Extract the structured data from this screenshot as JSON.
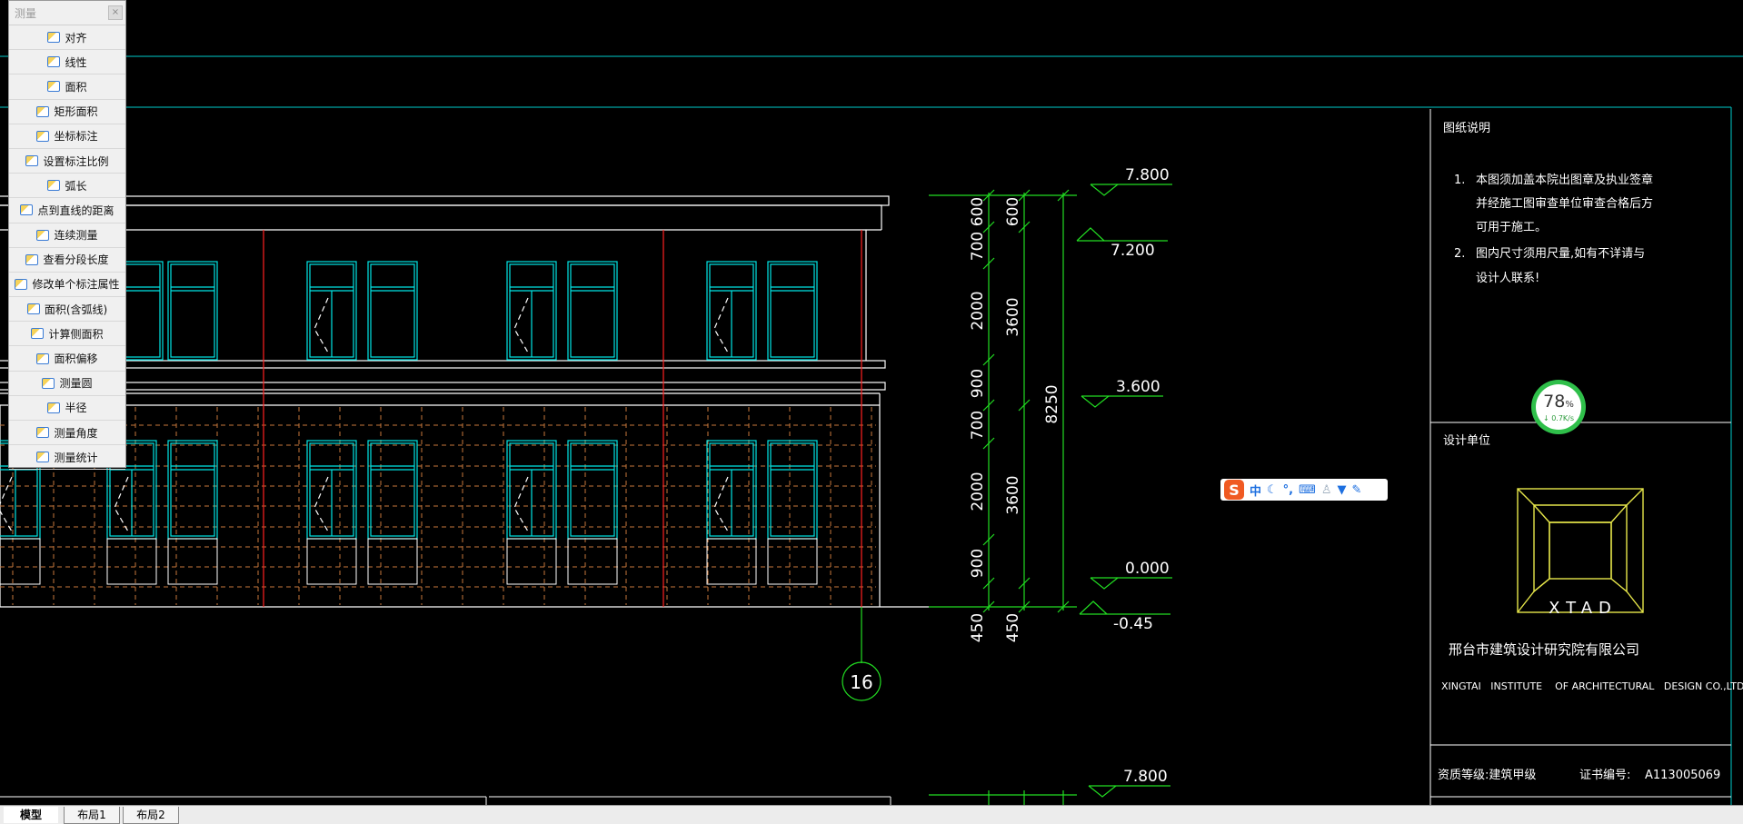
{
  "palette": {
    "title": "测量",
    "close_symbol": "×",
    "items": [
      {
        "label": "对齐",
        "icon": "align-measure-icon"
      },
      {
        "label": "线性",
        "icon": "linear-measure-icon"
      },
      {
        "label": "面积",
        "icon": "area-icon"
      },
      {
        "label": "矩形面积",
        "icon": "rect-area-icon"
      },
      {
        "label": "坐标标注",
        "icon": "coordinate-icon"
      },
      {
        "label": "设置标注比例",
        "icon": "scale-icon"
      },
      {
        "label": "弧长",
        "icon": "arc-length-icon"
      },
      {
        "label": "点到直线的距离",
        "icon": "point-line-distance-icon"
      },
      {
        "label": "连续测量",
        "icon": "continuous-measure-icon"
      },
      {
        "label": "查看分段长度",
        "icon": "segment-length-icon"
      },
      {
        "label": "修改单个标注属性",
        "icon": "edit-dimension-icon"
      },
      {
        "label": "面积(含弧线)",
        "icon": "arc-area-icon"
      },
      {
        "label": "计算侧面积",
        "icon": "side-area-icon"
      },
      {
        "label": "面积偏移",
        "icon": "area-offset-icon"
      },
      {
        "label": "测量圆",
        "icon": "measure-circle-icon"
      },
      {
        "label": "半径",
        "icon": "radius-icon"
      },
      {
        "label": "测量角度",
        "icon": "angle-icon"
      },
      {
        "label": "测量统计",
        "icon": "statistics-icon"
      }
    ]
  },
  "drawing": {
    "elevations": [
      "7.800",
      "7.200",
      "3.600",
      "0.000",
      "-0.45",
      "7.800"
    ],
    "dims_left": [
      "700",
      "600",
      "2000",
      "900",
      "700",
      "2000",
      "900",
      "450"
    ],
    "dims_mid": [
      "600",
      "3600",
      "3600",
      "450"
    ],
    "dim_total": "8250",
    "axis_label": "16",
    "colors": {
      "cyan": "#00e5e5",
      "green": "#22dd22",
      "red": "#ff2020",
      "orange": "#c8783c",
      "white": "#ffffff",
      "yellow": "#e6e64a"
    }
  },
  "title_block": {
    "notes_title": "图纸说明",
    "notes": [
      {
        "num": "1.",
        "lines": [
          "本图须加盖本院出图章及执业签章",
          "并经施工图审查单位审查合格后方",
          "可用于施工。"
        ]
      },
      {
        "num": "2.",
        "lines": [
          "图内尺寸须用尺量,如有不详请与",
          "设计人联系!"
        ]
      }
    ],
    "design_unit_label": "设计单位",
    "logo_text": "XTAD",
    "company_cn": "邢台市建筑设计研究院有限公司",
    "company_en": "XINGTAI   INSTITUTE    OF ARCHITECTURAL   DESIGN CO.,LTD",
    "grade": "资质等级:建筑甲级",
    "cert_label": "证书编号:",
    "cert_no": "A113005069"
  },
  "ime": {
    "lang": "中",
    "icons": [
      "moon-icon",
      "punctuation-icon",
      "keyboard-icon",
      "user-icon",
      "skin-icon",
      "wrench-icon"
    ]
  },
  "gauge": {
    "percent": "78",
    "percent_sign": "%",
    "rate": "↓ 0.7K/s"
  },
  "tabs": [
    {
      "label": "模型",
      "active": true
    },
    {
      "label": "布局1",
      "active": false
    },
    {
      "label": "布局2",
      "active": false
    }
  ]
}
